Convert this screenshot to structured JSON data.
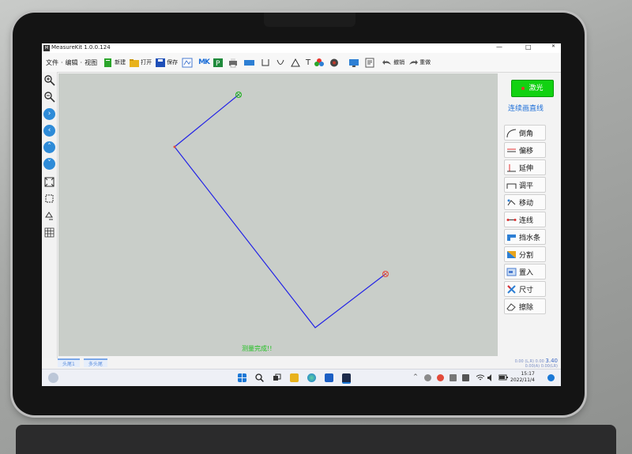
{
  "window": {
    "title": "MeasureKit 1.0.0.124",
    "minimize_glyph": "—",
    "maximize_glyph": "□",
    "close_glyph": "✕"
  },
  "menu": {
    "file": "文件",
    "edit": "编辑",
    "view": "视图",
    "new_label": "新建",
    "open_label": "打开",
    "save_label": "保存",
    "mk_label": "MK",
    "text_tool_label": "T",
    "undo_label": "撤销",
    "redo_label": "重做"
  },
  "right_panel": {
    "laser_label": "激光",
    "mode_label": "连续画直线",
    "tools": [
      {
        "label": "倒角",
        "icon": "chamfer-icon"
      },
      {
        "label": "偏移",
        "icon": "offset-icon"
      },
      {
        "label": "延伸",
        "icon": "extend-icon"
      },
      {
        "label": "调平",
        "icon": "level-icon"
      },
      {
        "label": "移动",
        "icon": "move-icon"
      },
      {
        "label": "连线",
        "icon": "connect-icon"
      },
      {
        "label": "挡水条",
        "icon": "water-bar-icon"
      },
      {
        "label": "分割",
        "icon": "split-icon"
      },
      {
        "label": "置入",
        "icon": "insert-icon"
      },
      {
        "label": "尺寸",
        "icon": "dimension-icon"
      },
      {
        "label": "擦除",
        "icon": "eraser-icon"
      }
    ]
  },
  "status": {
    "tab_left": "头尾1",
    "tab_right": "多头尾",
    "message": "测量完成!!",
    "right_small": "0.00 (L,R) 0.00",
    "value": "3.40",
    "right_small2": "0.00(A) 0.00(LR)"
  },
  "taskbar": {
    "time": "15:17",
    "date": "2022/11/4",
    "tray_arrow": "^"
  },
  "colors": {
    "accent": "#2e8bd8",
    "laser": "#12d212",
    "polyline": "#2323e6"
  }
}
